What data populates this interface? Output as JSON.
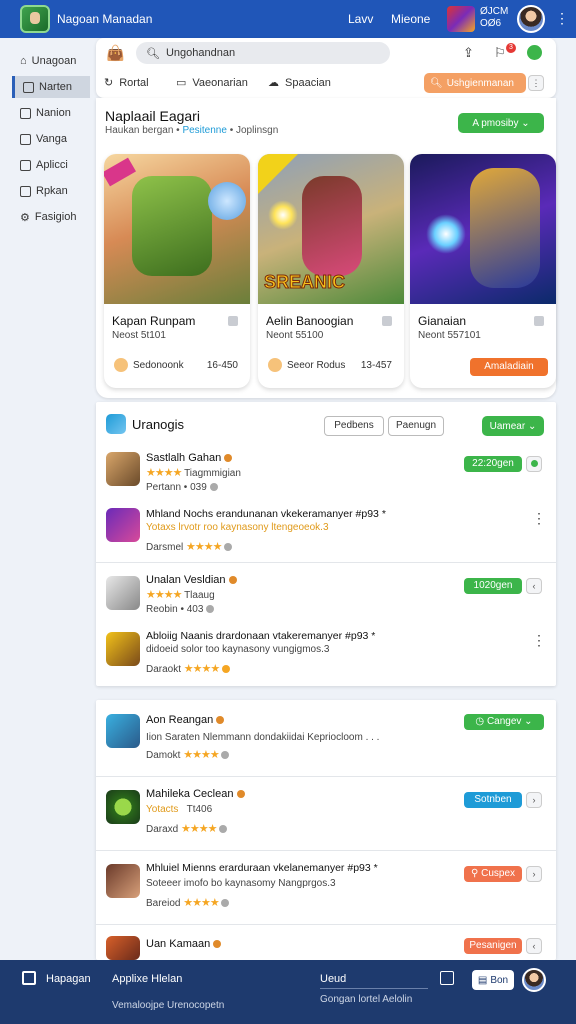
{
  "topbar": {
    "title": "Nagoan Manadan",
    "links": [
      "Lavv",
      "Mieone"
    ],
    "stat_line1": "ØJCM",
    "stat_line2": "OØ6"
  },
  "sidebar": {
    "items": [
      {
        "label": "Unagoan",
        "icon": "home-icon"
      },
      {
        "label": "Narten",
        "icon": "box-icon"
      },
      {
        "label": "Nanion",
        "icon": "box-icon"
      },
      {
        "label": "Vanga",
        "icon": "box-icon"
      },
      {
        "label": "Aplicci",
        "icon": "box-icon"
      },
      {
        "label": "Rpkan",
        "icon": "box-icon"
      },
      {
        "label": "Fasigioh",
        "icon": "gear-icon"
      }
    ],
    "active_index": 1
  },
  "toolbar": {
    "search_value": "Ungohandnan",
    "badge_count": "3",
    "tabs": [
      {
        "label": "Rortal",
        "icon": "refresh-icon"
      },
      {
        "label": "Vaeonarian",
        "icon": "monitor-icon"
      },
      {
        "label": "Spaacian",
        "icon": "cloud-icon"
      }
    ],
    "orange_button": "Ushgienmanan"
  },
  "featured": {
    "title": "Naplaail Eagari",
    "sub_prefix": "Haukan bergan •",
    "sub_highlight": "Pesitenne",
    "sub_suffix": "• Joplinsgn",
    "green_button": "A pmosiby",
    "cards": [
      {
        "title": "Kapan Runpam",
        "sub": "Neost 5t101",
        "foot": "Sedonoonk",
        "num": "16-450",
        "cta": ""
      },
      {
        "title": "Aelin Banoogian",
        "sub": "Neont 55100",
        "foot": "Seeor Rodus",
        "num": "13-457",
        "cta": ""
      },
      {
        "title": "Gianaian",
        "sub": "Neont 557101",
        "foot": "",
        "num": "",
        "cta": "Amaladiain"
      }
    ],
    "card2_overlay": "SREANIC"
  },
  "list1": {
    "title": "Uranogis",
    "btn1": "Pedbens",
    "btn2": "Paenugn",
    "green": "Uamear",
    "rows": [
      {
        "title": "Sastlalh Gahan",
        "line2": "Tiagmmigian",
        "line3": "Pertann • 039",
        "pill": "22:20gen",
        "pill_color": "#3cb54a"
      },
      {
        "title": "Mhland Nochs erandunanan vkekeramanyer #p93 *",
        "line2": "Yotaxs lrvotr roo kaynasony ltengeoeok.3",
        "line3": "Darsmel",
        "pill": "",
        "pill_color": ""
      },
      {
        "title": "Unalan Vesldian",
        "line2": "Tlaaug",
        "line3": "Reobin • 403",
        "pill": "1020gen",
        "pill_color": "#3cb54a"
      },
      {
        "title": "Abloiig Naanis drardonaan vtakeremanyer #p93 *",
        "line2": "didoeid solor too kaynasony vungigmos.3",
        "line3": "Daraokt",
        "pill": "",
        "pill_color": ""
      }
    ]
  },
  "list2": {
    "rows": [
      {
        "title": "Aon Reangan",
        "line2": "Iion Saraten Nlemmann dondakiidai Kepriocloom . . .",
        "line3": "Damokt",
        "pill": "Cangev",
        "pill_color": "#3cb54a"
      },
      {
        "title": "Mahileka Ceclean",
        "line2": "Yotacts",
        "line2b": "Tt406",
        "line3": "Daraxd",
        "pill": "Sotnben",
        "pill_color": "#1e9bd7"
      },
      {
        "title": "Mhluiel Mienns erarduraan vkelanemanyer #p93 *",
        "line2": "Soteeer imofo bo kaynasomy Nangprgos.3",
        "line3": "Bareiod",
        "pill": "Cuspex",
        "pill_color": "#f0724c"
      },
      {
        "title": "Uan Kamaan",
        "line2": "",
        "line3": "",
        "pill": "Pesanigen",
        "pill_color": "#f0724c"
      }
    ]
  },
  "bottom": {
    "left_label": "Hapagan",
    "app_label": "Applixe Hlelan",
    "app_sub": "Vemaloojpe Urenocopetn",
    "mid_label": "Ueud",
    "mid_sub": "Gongan lortel Aelolin",
    "btn": "Bon"
  }
}
